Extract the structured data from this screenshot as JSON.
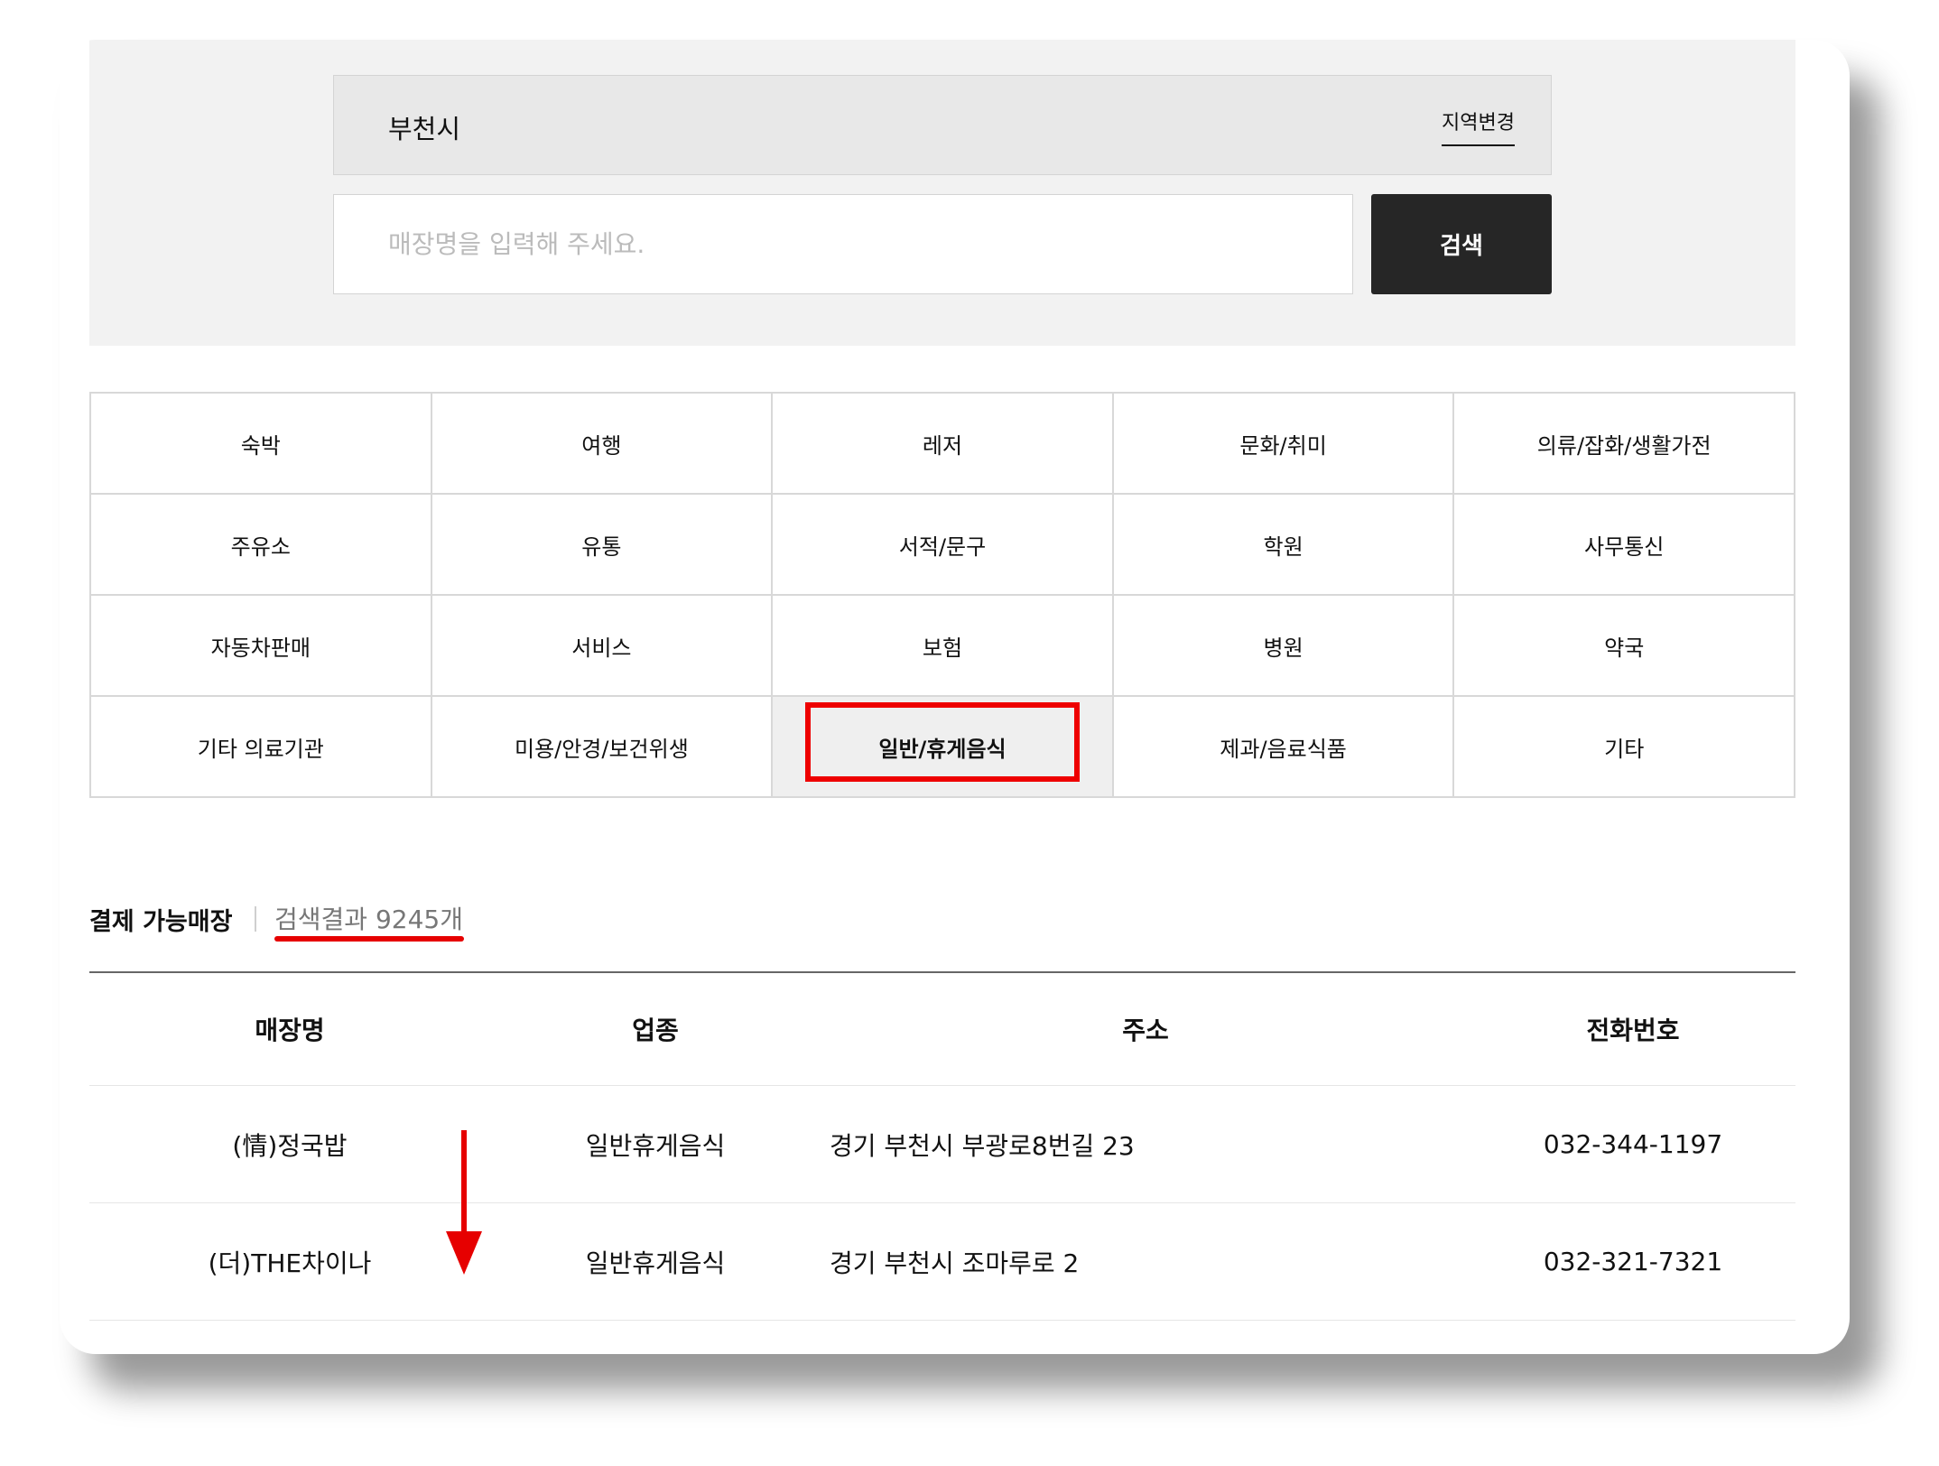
{
  "region": {
    "name": "부천시",
    "change_label": "지역변경"
  },
  "search": {
    "placeholder": "매장명을 입력해 주세요.",
    "value": "",
    "button_label": "검색"
  },
  "categories": [
    "숙박",
    "여행",
    "레저",
    "문화/취미",
    "의류/잡화/생활가전",
    "주유소",
    "유통",
    "서적/문구",
    "학원",
    "사무통신",
    "자동차판매",
    "서비스",
    "보험",
    "병원",
    "약국",
    "기타 의료기관",
    "미용/안경/보건위생",
    "일반/휴게음식",
    "제과/음료식품",
    "기타"
  ],
  "selected_category": "일반/휴게음식",
  "results": {
    "title": "결제 가능매장",
    "count_text": "검색결과 9245개"
  },
  "table": {
    "headers": [
      "매장명",
      "업종",
      "주소",
      "전화번호"
    ],
    "rows": [
      [
        "(情)정국밥",
        "일반휴게음식",
        "경기 부천시 부광로8번길 23",
        "032-344-1197"
      ],
      [
        "(더)THE차이나",
        "일반휴게음식",
        "경기 부천시 조마루로 2",
        "032-321-7321"
      ]
    ]
  },
  "colors": {
    "accent": "#e60000",
    "search_button": "#262626",
    "panel_bg": "#f2f2f2"
  }
}
